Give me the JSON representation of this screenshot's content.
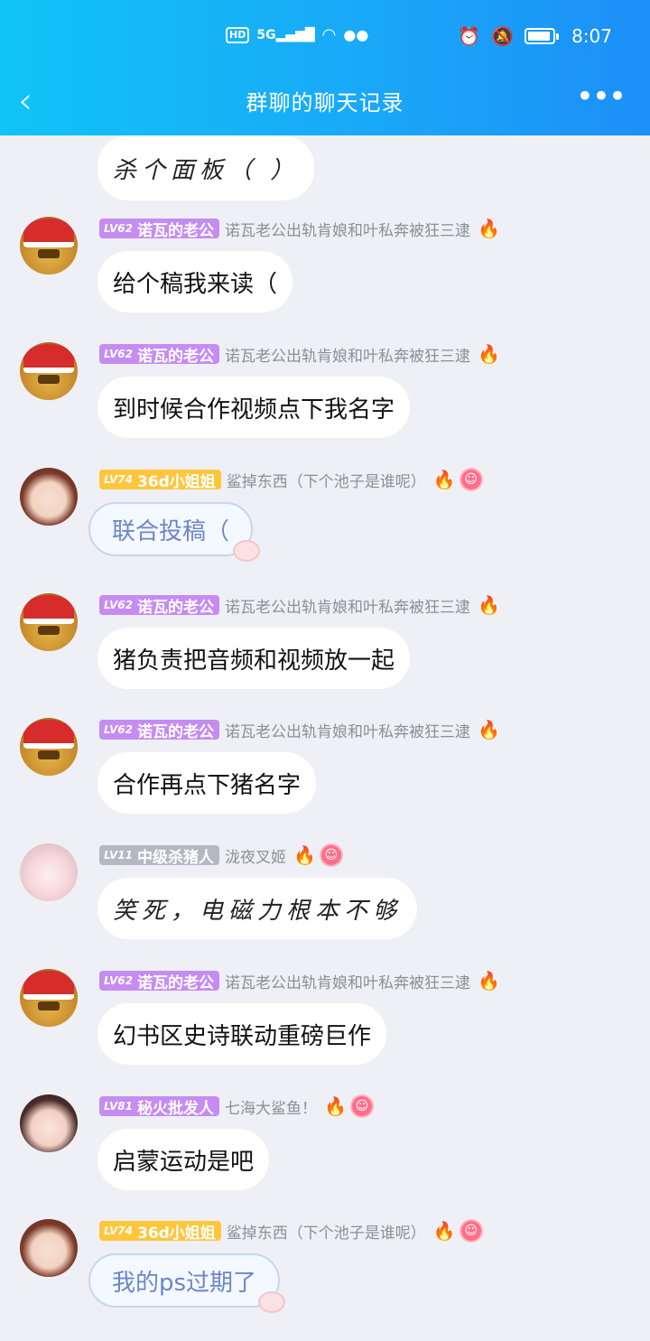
{
  "status_bar": {
    "hd": "HD",
    "network": "5G",
    "time": "8:07",
    "icons": [
      "signal-icon",
      "wifi-icon",
      "wechat-icon",
      "alarm-icon",
      "mute-icon",
      "battery-icon"
    ]
  },
  "nav": {
    "title": "群聊的聊天记录",
    "back_icon": "‹",
    "more_icon": "•••"
  },
  "colors": {
    "header_gradient_start": "#10c4f6",
    "header_gradient_end": "#1c8ff8",
    "background": "#eef0f6",
    "badge_purple": "#c58cf2",
    "badge_gold": "#ffc63c",
    "badge_gray": "#b3b8c2"
  },
  "messages": [
    {
      "level": "",
      "name": "",
      "nick": "",
      "text": "杀个面板（ ）",
      "badge_color": "none",
      "style": "script",
      "avatar": "girl-pink"
    },
    {
      "level": "LV62",
      "name": "诺瓦的老公",
      "nick": "诺瓦老公出轨肯娘和叶私奔被狂三逮",
      "text": "给个稿我来读（",
      "badge_color": "purple",
      "style": "normal",
      "avatar": "chick",
      "flame": "🔥"
    },
    {
      "level": "LV62",
      "name": "诺瓦的老公",
      "nick": "诺瓦老公出轨肯娘和叶私奔被狂三逮",
      "text": "到时候合作视频点下我名字",
      "badge_color": "purple",
      "style": "normal",
      "avatar": "chick",
      "flame": "🔥"
    },
    {
      "level": "LV74",
      "name": "36d小姐姐",
      "nick": "鲨掉东西（下个池子是谁呢）",
      "text": "联合投稿（",
      "badge_color": "gold",
      "style": "cute",
      "avatar": "girl-brown",
      "flame": "🔥",
      "medal": "☺"
    },
    {
      "level": "LV62",
      "name": "诺瓦的老公",
      "nick": "诺瓦老公出轨肯娘和叶私奔被狂三逮",
      "text": "猪负责把音频和视频放一起",
      "badge_color": "purple",
      "style": "normal",
      "avatar": "chick",
      "flame": "🔥"
    },
    {
      "level": "LV62",
      "name": "诺瓦的老公",
      "nick": "诺瓦老公出轨肯娘和叶私奔被狂三逮",
      "text": "合作再点下猪名字",
      "badge_color": "purple",
      "style": "normal",
      "avatar": "chick",
      "flame": "🔥"
    },
    {
      "level": "LV11",
      "name": "中级杀猪人",
      "nick": "泷夜叉姬",
      "text": "笑死，电磁力根本不够",
      "badge_color": "gray",
      "style": "script",
      "avatar": "girl-pink",
      "flame": "🔥",
      "medal": "☺"
    },
    {
      "level": "LV62",
      "name": "诺瓦的老公",
      "nick": "诺瓦老公出轨肯娘和叶私奔被狂三逮",
      "text": "幻书区史诗联动重磅巨作",
      "badge_color": "purple",
      "style": "normal",
      "avatar": "chick",
      "flame": "🔥"
    },
    {
      "level": "LV81",
      "name": "秘火批发人",
      "nick": "七海大鲨鱼！",
      "text": "启蒙运动是吧",
      "badge_color": "purple",
      "style": "normal",
      "avatar": "girl-dark",
      "flame": "🔥",
      "medal": "☺"
    },
    {
      "level": "LV74",
      "name": "36d小姐姐",
      "nick": "鲨掉东西（下个池子是谁呢）",
      "text": "我的ps过期了",
      "badge_color": "gold",
      "style": "cute",
      "avatar": "girl-brown",
      "flame": "🔥",
      "medal": "☺"
    }
  ]
}
